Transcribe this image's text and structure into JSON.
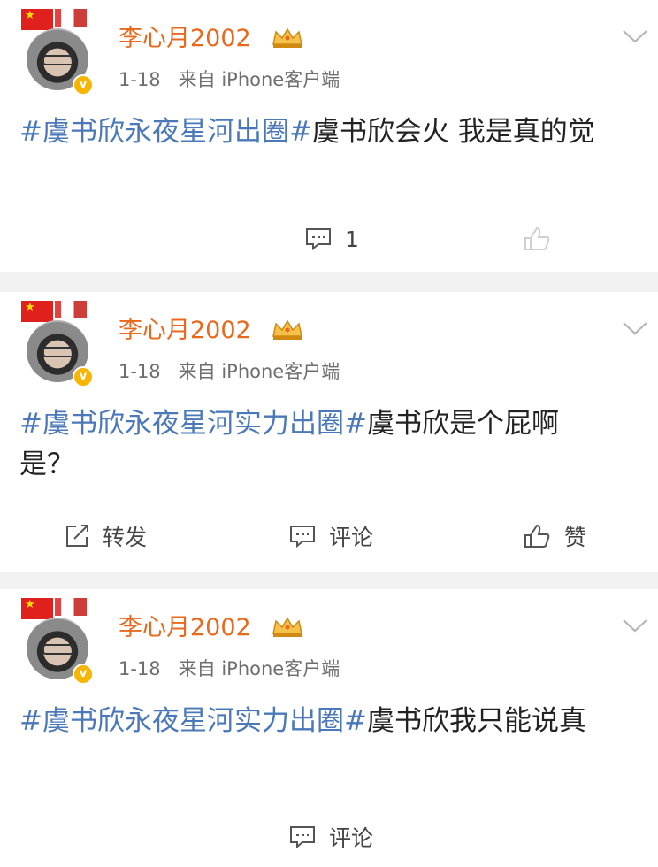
{
  "posts": [
    {
      "username": "李心月2002",
      "date": "1-18",
      "source": "来自 iPhone客户端",
      "tags_1": "#虞书欣永夜星河出圈#",
      "text_1": "虞书欣会火 我是真的觉",
      "actions": {
        "comment_count": "1"
      }
    },
    {
      "username": "李心月2002",
      "date": "1-18",
      "source": "来自 iPhone客户端",
      "tags_1": "#虞书欣永夜星河实力出圈#",
      "text_1": "虞书欣是个屁啊",
      "text_2": "是？",
      "actions": {
        "repost": "转发",
        "comment": "评论",
        "like": "赞"
      }
    },
    {
      "username": "李心月2002",
      "date": "1-18",
      "source": "来自 iPhone客户端",
      "tags_1": "#虞书欣永夜星河实力出圈#",
      "text_1": "虞书欣我只能说真",
      "actions": {
        "comment": "评论"
      }
    }
  ],
  "colors": {
    "username": "#e8691e",
    "hashtag": "#4a78b8",
    "verified": "#f7b500"
  },
  "icons": [
    "crown-icon",
    "chevron-down-icon",
    "comment-icon",
    "repost-icon",
    "like-icon",
    "verified-badge-icon"
  ]
}
